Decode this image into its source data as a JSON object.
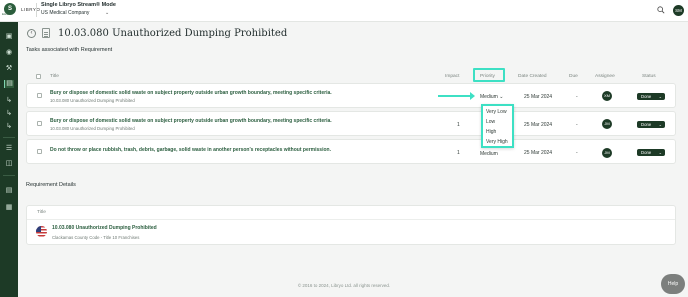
{
  "header": {
    "brand_logo_text": "S",
    "brand_logo_sub": "EHM",
    "brand_name": "LIBRYO",
    "mode_title": "Single Libryo Stream® Mode",
    "company": "US Medical Company",
    "user_initials": "SM"
  },
  "page": {
    "title": "10.03.080 Unauthorized Dumping Prohibited",
    "tasks_section": "Tasks associated with Requirement",
    "details_section": "Requirement Details"
  },
  "table": {
    "columns": {
      "title": "Title",
      "impact": "Impact",
      "priority": "Priority",
      "date_created": "Date Created",
      "due": "Due",
      "assignee": "Assignee",
      "status": "Status"
    },
    "rows": [
      {
        "title": "Bury or dispose of domestic solid waste on subject property outside urban growth boundary, meeting specific criteria.",
        "sub": "10.03.080 Unauthorized Dumping Prohibited",
        "impact": "",
        "priority": "Medium",
        "date": "25 Mar 2024",
        "due": "-",
        "assignee": "XM",
        "status": "Done"
      },
      {
        "title": "Bury or dispose of domestic solid waste on subject property outside urban growth boundary, meeting specific criteria.",
        "sub": "10.03.080 Unauthorized Dumping Prohibited",
        "impact": "1",
        "priority": "",
        "date": "25 Mar 2024",
        "due": "-",
        "assignee": "JM",
        "status": "Done"
      },
      {
        "title": "Do not throw or place rubbish, trash, debris, garbage, solid waste in another person's receptacles without permission.",
        "sub": "",
        "impact": "1",
        "priority": "Medium",
        "date": "25 Mar 2024",
        "due": "-",
        "assignee": "JM",
        "status": "Done"
      }
    ]
  },
  "priority_dropdown": {
    "options": [
      "Very Low",
      "Low",
      "High",
      "Very High"
    ]
  },
  "requirement": {
    "column_title": "Title",
    "title": "10.03.080 Unauthorized Dumping Prohibited",
    "sub": "Clackamas County Code - Title 10 Franchises"
  },
  "footer": {
    "text": "© 2016 to 2024, Libryo Ltd. all rights reserved."
  },
  "help": {
    "label": "Help"
  },
  "colors": {
    "sidebar": "#1d3a26",
    "accent_highlight": "#3de0c4",
    "link_green": "#2b5e3f"
  },
  "icons": {
    "sidebar": [
      "dashboard-icon",
      "bell-icon",
      "wrench-icon",
      "clipboard-icon",
      "share-icon",
      "share-icon",
      "share-icon",
      "list-icon",
      "folder-icon",
      "document-icon",
      "org-chart-icon"
    ]
  }
}
